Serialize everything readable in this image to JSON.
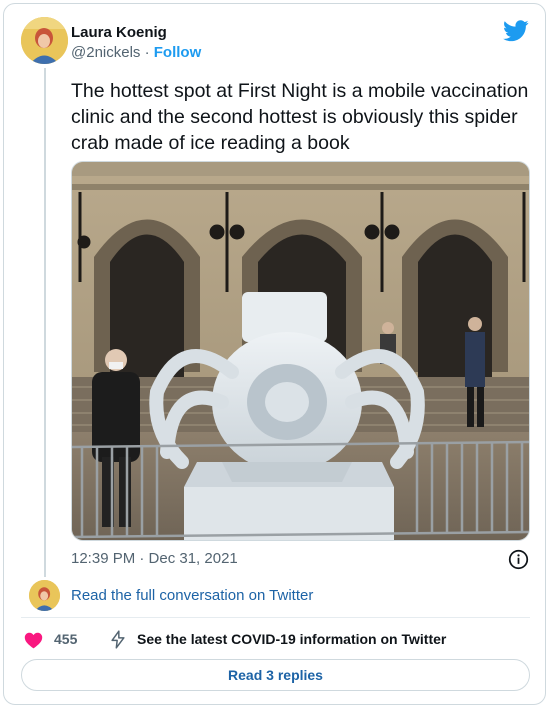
{
  "author": {
    "name": "Laura Koenig",
    "handle": "@2nickels",
    "separator": "·",
    "follow_label": "Follow"
  },
  "tweet": {
    "text": "The hottest spot at First Night is a mobile vaccination clinic and the second hottest is obviously this spider crab made of ice reading a book",
    "timestamp": "12:39 PM · Dec 31, 2021"
  },
  "conversation_link": "Read the full conversation on Twitter",
  "actions": {
    "like_count": "455",
    "covid_link": "See the latest COVID-19 information on Twitter"
  },
  "replies_button": "Read 3 replies",
  "colors": {
    "brand": "#1d9bf0",
    "link": "#1d63a6",
    "heart": "#f91880",
    "muted": "#536471"
  },
  "icons": [
    "twitter-bird-icon",
    "info-icon",
    "heart-icon",
    "covid-bolt-icon"
  ]
}
